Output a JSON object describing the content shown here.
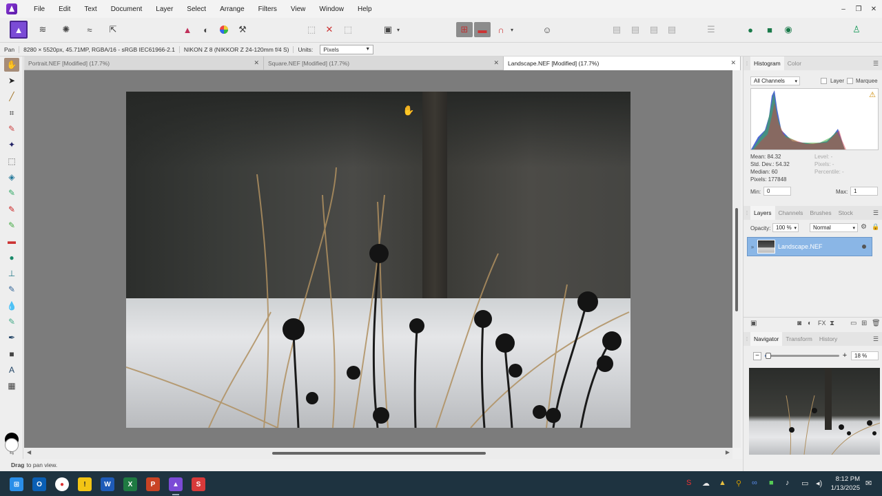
{
  "app": {
    "menu": [
      "File",
      "Edit",
      "Text",
      "Document",
      "Layer",
      "Select",
      "Arrange",
      "Filters",
      "View",
      "Window",
      "Help"
    ],
    "window_controls": {
      "minimize": "–",
      "restore": "❐",
      "close": "✕"
    }
  },
  "toolbar": {
    "persona_icon": "photo-persona-icon",
    "icons": [
      "liquify-persona-icon",
      "develop-persona-icon",
      "tone-mapping-persona-icon",
      "export-persona-icon",
      "levels-icon",
      "auto-contrast-icon",
      "color-wheel-icon",
      "white-balance-icon",
      "marquee-icon",
      "no-selection-icon",
      "snapping-icon",
      "quickmask-icon",
      "assistant-icon",
      "arrange-icons",
      "align-icon",
      "team-icon",
      "account-icon"
    ]
  },
  "context": {
    "tool": "Pan",
    "doc_info": "8280 × 5520px, 45.71MP, RGBA/16 - sRGB IEC61966-2.1",
    "camera": "NIKON Z 8 (NIKKOR Z 24-120mm f/4 S)",
    "units_label": "Units:",
    "units_value": "Pixels"
  },
  "tabs": [
    {
      "label": "Portrait.NEF [Modified] (17.7%)",
      "active": false
    },
    {
      "label": "Square.NEF [Modified] (17.7%)",
      "active": false
    },
    {
      "label": "Landscape.NEF [Modified] (17.7%)",
      "active": true
    }
  ],
  "status": {
    "bold": "Drag",
    "text": "to pan view."
  },
  "histogram": {
    "tabs": [
      "Histogram",
      "Color"
    ],
    "channel": "All Channels",
    "check_layer": "Layer",
    "check_marquee": "Marquee",
    "mean": "Mean: 84.32",
    "std": "Std. Dev.: 54.32",
    "median": "Median: 60",
    "pixels": "Pixels: 177848",
    "level": "Level: -",
    "pixels_r": "Pixels: -",
    "percentile": "Percentile: -",
    "min_label": "Min:",
    "min_value": "0",
    "max_label": "Max:",
    "max_value": "1"
  },
  "layers": {
    "tabs": [
      "Layers",
      "Channels",
      "Brushes",
      "Stock"
    ],
    "opacity_label": "Opacity:",
    "opacity_value": "100 %",
    "blend": "Normal",
    "layer_name": "Landscape.NEF"
  },
  "navigator": {
    "tabs": [
      "Navigator",
      "Transform",
      "History"
    ],
    "zoom": "18 %",
    "zoom_fraction": 0.05
  },
  "taskbar": {
    "time": "8:12 PM",
    "date": "1/13/2025"
  }
}
